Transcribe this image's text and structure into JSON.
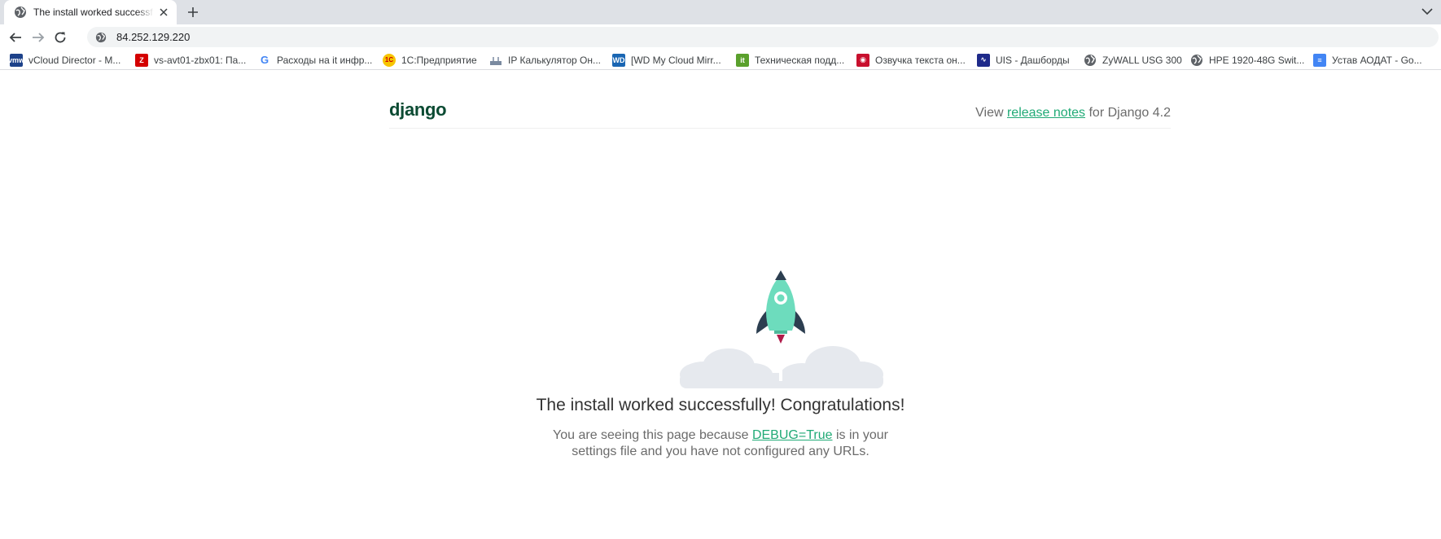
{
  "browser": {
    "tab_title": "The install worked successfully! Congratulations!",
    "url": "84.252.129.220",
    "bookmarks": [
      {
        "label": "vCloud Director - M...",
        "icon": "vmware-icon",
        "color": "#1d428a",
        "glyph": "vmw"
      },
      {
        "label": "vs-avt01-zbx01: Па...",
        "icon": "zabbix-icon",
        "color": "#d40000",
        "glyph": "Z"
      },
      {
        "label": "Расходы на it инфр...",
        "icon": "google-icon",
        "color": "#4285f4",
        "glyph": "G"
      },
      {
        "label": "1С:Предприятие",
        "icon": "1c-icon",
        "color": "#f7c500",
        "glyph": "1С"
      },
      {
        "label": "IP Калькулятор Он...",
        "icon": "network-icon",
        "color": "#7a8aa0",
        "glyph": ""
      },
      {
        "label": "[WD My Cloud Mirr...",
        "icon": "wd-icon",
        "color": "#1a66b3",
        "glyph": "WD"
      },
      {
        "label": "Техническая подд...",
        "icon": "it-icon",
        "color": "#5aa02c",
        "glyph": "it"
      },
      {
        "label": "Озвучка текста он...",
        "icon": "voice-icon",
        "color": "#c8102e",
        "glyph": "◉"
      },
      {
        "label": "UIS - Дашборды",
        "icon": "uis-icon",
        "color": "#1e2a8a",
        "glyph": "∿"
      },
      {
        "label": "ZyWALL USG 300",
        "icon": "globe-icon",
        "color": "#5f6368",
        "glyph": ""
      },
      {
        "label": "HPE 1920-48G Swit...",
        "icon": "globe-icon",
        "color": "#5f6368",
        "glyph": ""
      },
      {
        "label": "Устав АОДАТ - Go...",
        "icon": "google-docs-icon",
        "color": "#4285f4",
        "glyph": "≡"
      }
    ]
  },
  "page": {
    "logo": "django",
    "notes_prefix": "View",
    "notes_link": "release notes",
    "notes_suffix": "for Django 4.2",
    "title": "The install worked successfully! Congratulations!",
    "sub_prefix": "You are seeing this page because",
    "sub_link": "DEBUG=True",
    "sub_suffix_line1": "is in your",
    "sub_line2": "settings file and you have not configured any URLs."
  },
  "colors": {
    "brand_dark": "#0C4B33",
    "brand_accent": "#20AA76",
    "rocket_body": "#6DDCBD",
    "rocket_fins": "#2C3E50",
    "cloud": "#E6E9EE"
  }
}
